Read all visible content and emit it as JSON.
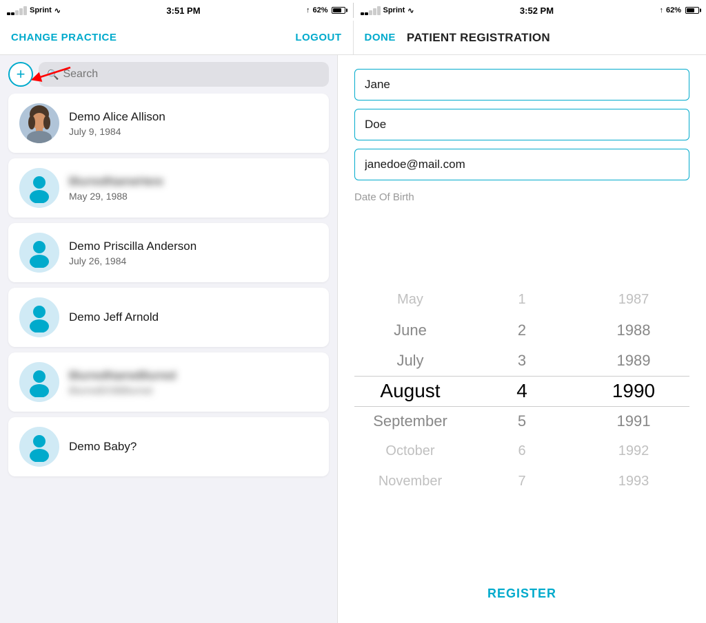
{
  "leftStatusBar": {
    "signals": "●●○○○",
    "carrier": "Sprint",
    "wifi": "wifi",
    "time": "3:51 PM",
    "location": "↑",
    "battery": "62%"
  },
  "rightStatusBar": {
    "signals": "●●○○○",
    "carrier": "Sprint",
    "wifi": "wifi",
    "time": "3:52 PM",
    "location": "↑",
    "battery": "62%"
  },
  "leftNav": {
    "changePractice": "CHANGE PRACTICE",
    "logout": "LOGOUT"
  },
  "rightNav": {
    "done": "DONE",
    "title": "PATIENT REGISTRATION"
  },
  "search": {
    "placeholder": "Search"
  },
  "patients": [
    {
      "name": "Demo Alice Allison",
      "dob": "July 9, 1984",
      "hasPhoto": true,
      "blurred": false
    },
    {
      "name": "BLURRED",
      "dob": "May 29, 1988",
      "hasPhoto": false,
      "blurred": true
    },
    {
      "name": "Demo Priscilla Anderson",
      "dob": "July 26, 1984",
      "hasPhoto": false,
      "blurred": false
    },
    {
      "name": "Demo Jeff Arnold",
      "dob": "",
      "hasPhoto": false,
      "blurred": false
    },
    {
      "name": "BLURRED",
      "dob": "BLURRED",
      "hasPhoto": false,
      "blurred": true
    },
    {
      "name": "Demo Baby?",
      "dob": "",
      "hasPhoto": false,
      "blurred": false
    }
  ],
  "form": {
    "firstName": "Jane",
    "lastName": "Doe",
    "email": "janedoe@mail.com",
    "dobLabel": "Date Of Birth"
  },
  "datePicker": {
    "months": [
      "May",
      "June",
      "July",
      "August",
      "September",
      "October",
      "November"
    ],
    "days": [
      "1",
      "2",
      "3",
      "4",
      "5",
      "6",
      "7"
    ],
    "years": [
      "1987",
      "1988",
      "1989",
      "1990",
      "1991",
      "1992",
      "1993"
    ],
    "selectedIndex": 3
  },
  "register": {
    "label": "REGISTER"
  }
}
